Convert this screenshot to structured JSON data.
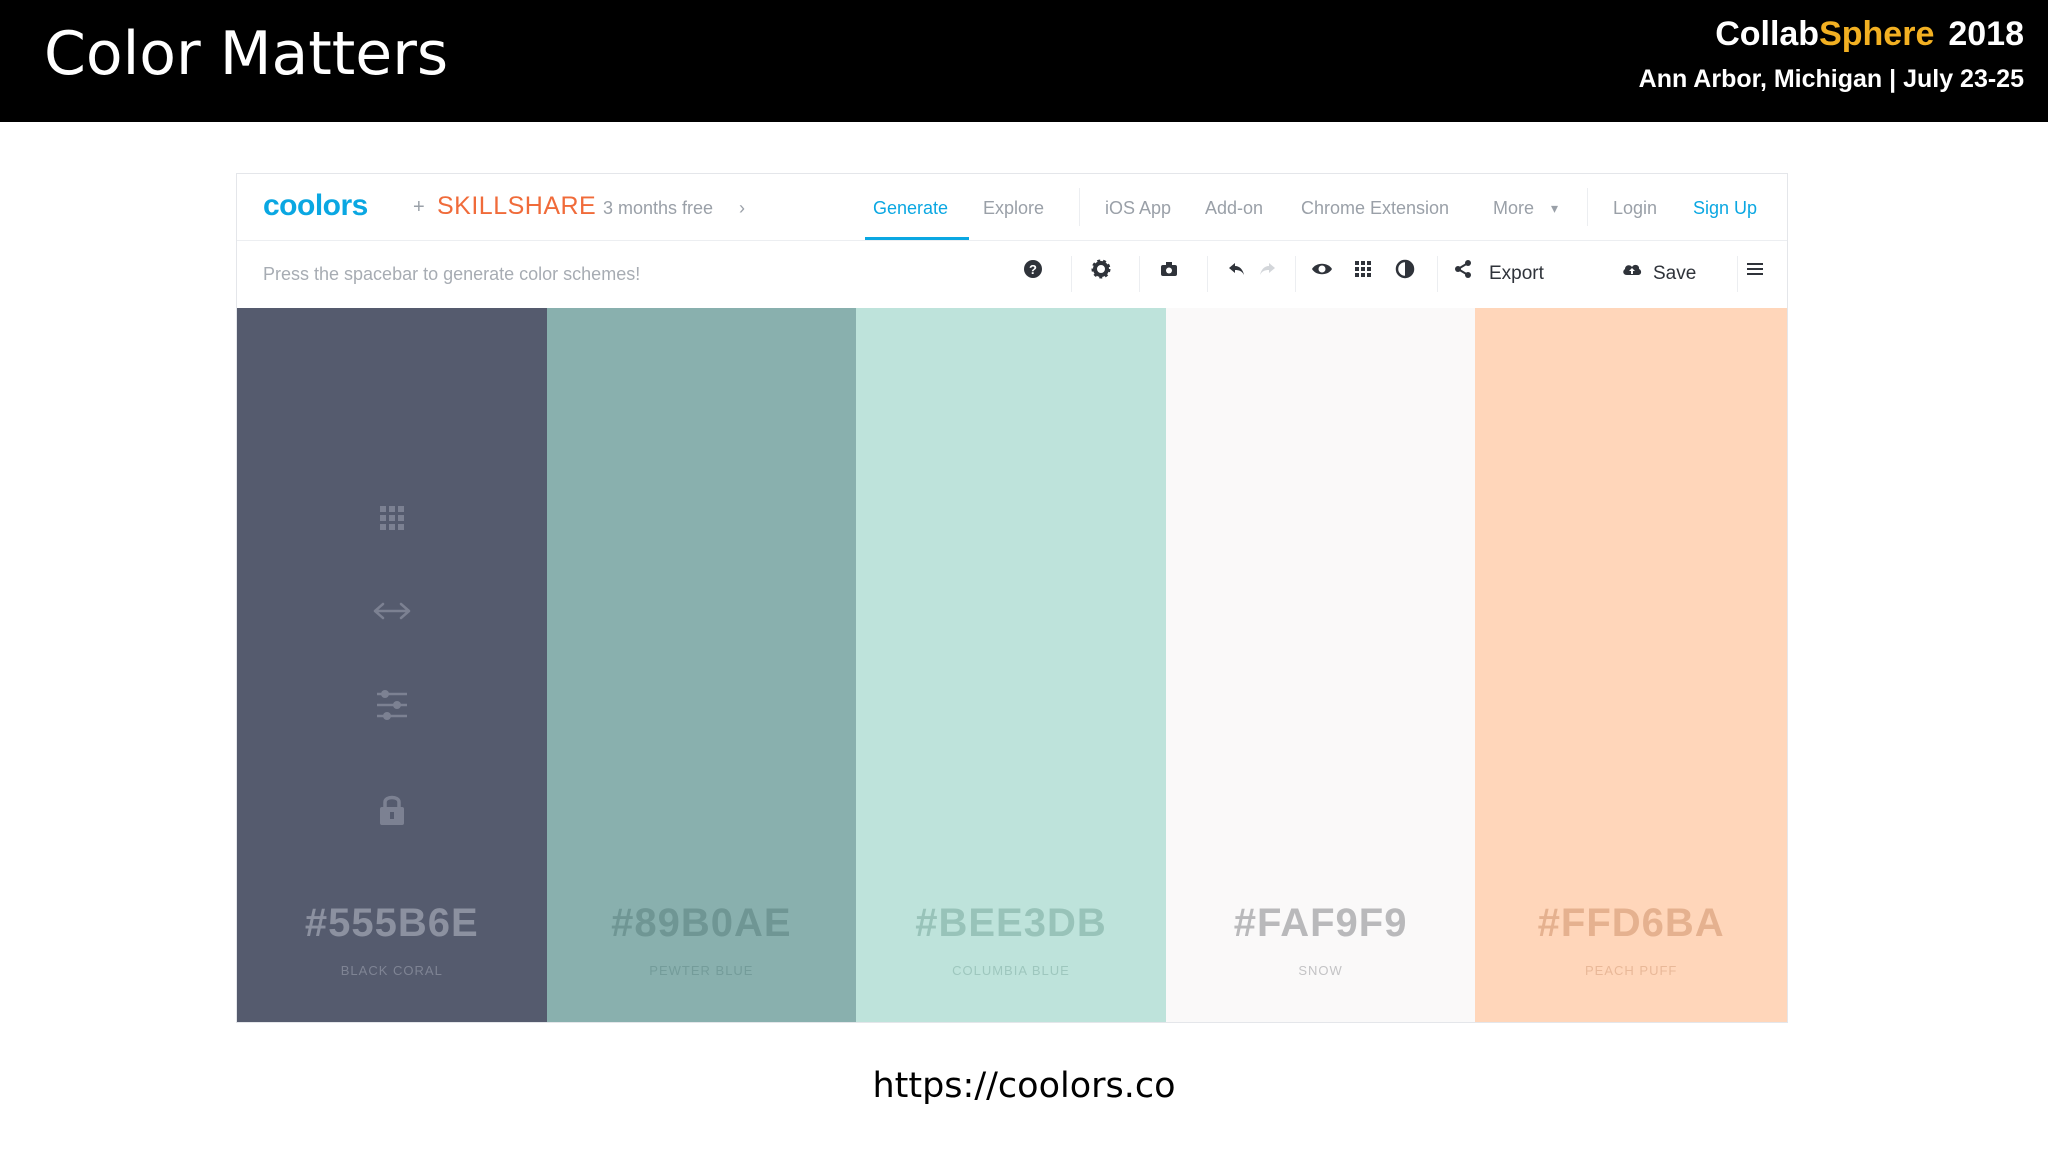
{
  "slide": {
    "title": "Color Matters",
    "brand_collab": "Collab",
    "brand_sphere": "Sphere",
    "brand_year": "2018",
    "subtitle": "Ann Arbor, Michigan | July 23-25",
    "url": "https://coolors.co"
  },
  "nav": {
    "logo": "coolors",
    "plus": "+",
    "partner": "SKILLSHARE",
    "promo": "3 months free",
    "items": [
      "Generate",
      "Explore",
      "iOS App",
      "Add-on",
      "Chrome Extension",
      "More",
      "Login",
      "Sign Up"
    ]
  },
  "toolbar": {
    "hint": "Press the spacebar to generate color schemes!",
    "export_label": "Export",
    "save_label": "Save",
    "icons": [
      "help-icon",
      "gear-icon",
      "camera-icon",
      "undo-icon",
      "redo-icon",
      "eye-icon",
      "grid-icon",
      "adjust-icon",
      "share-icon",
      "cloud-icon",
      "menu-icon"
    ]
  },
  "palette": [
    {
      "hex": "#555B6E",
      "name": "BLACK CORAL",
      "bg": "#555b6e",
      "text": "#8c91a0",
      "name_color": "#7f8494"
    },
    {
      "hex": "#89B0AE",
      "name": "PEWTER BLUE",
      "bg": "#89b0ae",
      "text": "#6f9694",
      "name_color": "#749c9a"
    },
    {
      "hex": "#BEE3DB",
      "name": "COLUMBIA BLUE",
      "bg": "#bee3db",
      "text": "#98c3b9",
      "name_color": "#9ec7be"
    },
    {
      "hex": "#FAF9F9",
      "name": "SNOW",
      "bg": "#faf9f9",
      "text": "#b9b9bb",
      "name_color": "#c3c3c5"
    },
    {
      "hex": "#FFD6BA",
      "name": "PEACH PUFF",
      "bg": "#ffd6ba",
      "text": "#e5b18f",
      "name_color": "#e9b898"
    }
  ],
  "swatch_icons": [
    "apps-icon",
    "drag-arrows-icon",
    "sliders-icon",
    "lock-icon"
  ],
  "colors": {
    "accent": "#0aa7e2",
    "partner": "#f06b3a",
    "brand_highlight": "#f2b022"
  }
}
